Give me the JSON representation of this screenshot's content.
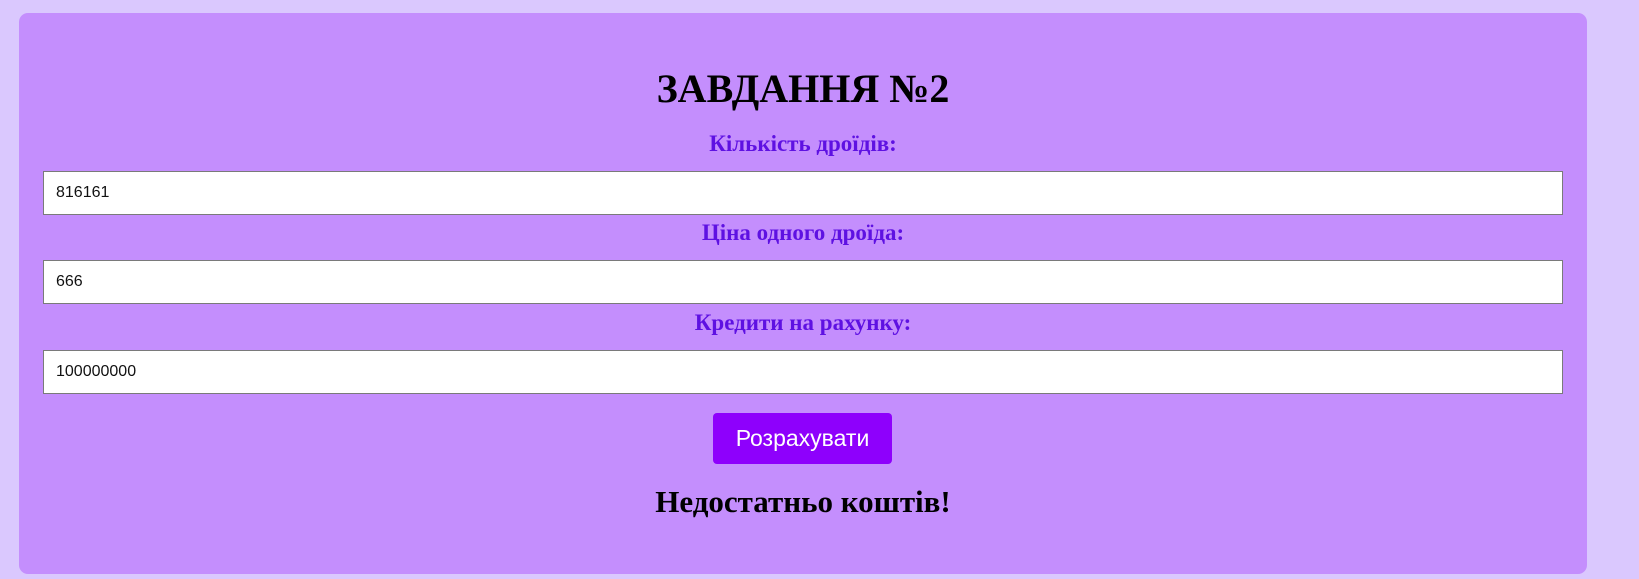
{
  "task": {
    "title": "ЗАВДАННЯ №2"
  },
  "form": {
    "droid_count": {
      "label": "Кількість дроїдів:",
      "value": "816161"
    },
    "droid_price": {
      "label": "Ціна одного дроїда:",
      "value": "666"
    },
    "credits": {
      "label": "Кредити на рахунку:",
      "value": "100000000"
    },
    "submit_label": "Розрахувати"
  },
  "result": {
    "message": "Недостатньо коштів!"
  },
  "colors": {
    "page_background": "#dac8fe",
    "card_background": "#c48efd",
    "label_color": "#5e11e2",
    "button_background": "#8e00fc"
  }
}
